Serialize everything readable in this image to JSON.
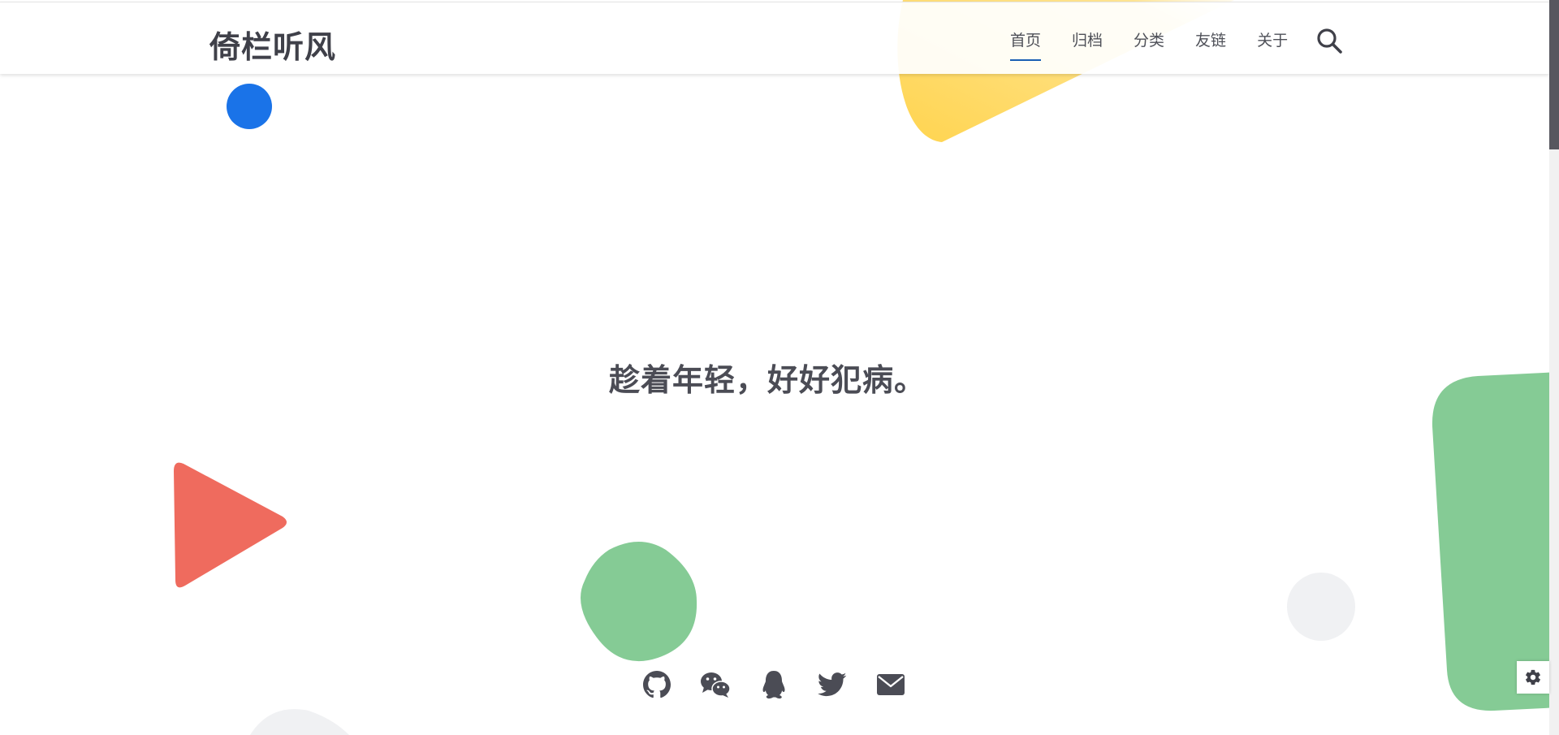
{
  "site": {
    "brand": "倚栏听风"
  },
  "nav": {
    "items": [
      {
        "label": "首页",
        "active": true
      },
      {
        "label": "归档",
        "active": false
      },
      {
        "label": "分类",
        "active": false
      },
      {
        "label": "友链",
        "active": false
      },
      {
        "label": "关于",
        "active": false
      }
    ],
    "search_icon": "search-icon"
  },
  "hero": {
    "motto": "趁着年轻，好好犯病。"
  },
  "social": {
    "icons": [
      "github-icon",
      "wechat-icon",
      "qq-icon",
      "twitter-icon",
      "mail-icon"
    ]
  },
  "settings": {
    "icon": "gear-icon"
  },
  "colors": {
    "text": "#4b4c55",
    "active_underline": "#1a5fb4",
    "blue": "#1a73e8",
    "red": "#ef6b5e",
    "green": "#85cb95",
    "yellow": "#ffd966",
    "grey": "#f0f1f3"
  }
}
